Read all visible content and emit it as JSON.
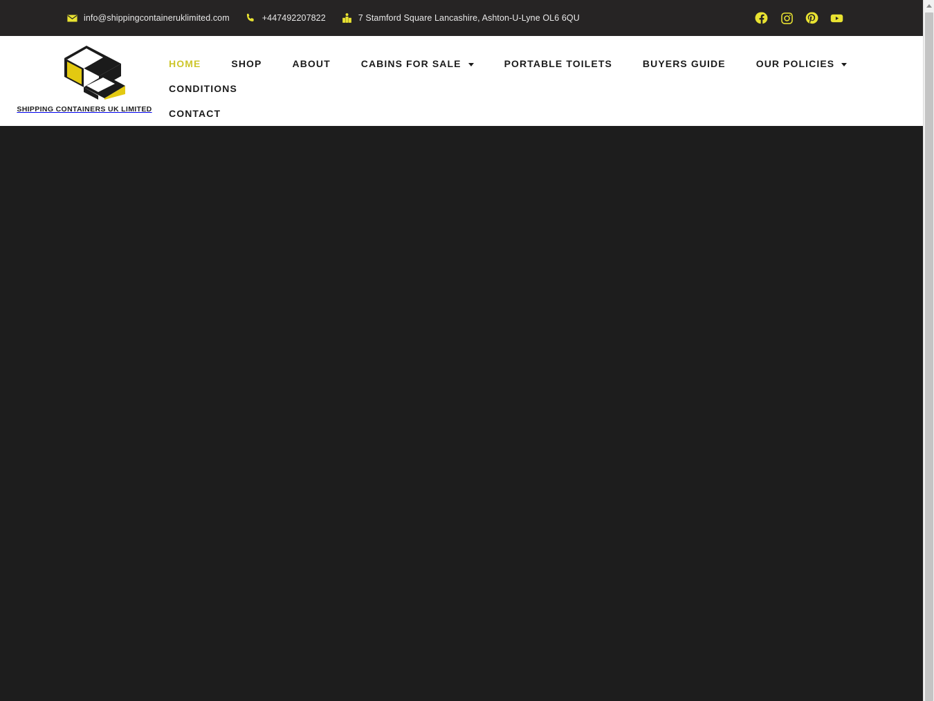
{
  "topbar": {
    "contacts": [
      {
        "icon": "envelope-icon",
        "label": "info@shippingcontaineruklimited.com",
        "name": "email"
      },
      {
        "icon": "phone-icon",
        "label": "+447492207822",
        "name": "phone"
      },
      {
        "icon": "map-location-icon",
        "label": "7 Stamford Square Lancashire, Ashton-U-Lyne OL6 6QU",
        "name": "address"
      }
    ],
    "socials": [
      {
        "icon": "facebook-icon",
        "name": "facebook"
      },
      {
        "icon": "instagram-icon",
        "name": "instagram"
      },
      {
        "icon": "pinterest-icon",
        "name": "pinterest"
      },
      {
        "icon": "youtube-icon",
        "name": "youtube"
      }
    ],
    "background_color": "#262424",
    "accent_color": "#e8e231"
  },
  "logo": {
    "text": "SHIPPING CONTAINERS UK LIMITED",
    "icon": "shipping-container-logo-icon",
    "colors": {
      "yellow": "#e3c911",
      "black": "#1b1b1b",
      "white": "#ffffff"
    }
  },
  "nav": {
    "row1": [
      {
        "label": "HOME",
        "active": true,
        "caret": false
      },
      {
        "label": "SHOP",
        "active": false,
        "caret": false
      },
      {
        "label": "ABOUT",
        "active": false,
        "caret": false
      },
      {
        "label": "CABINS FOR SALE",
        "active": false,
        "caret": true
      },
      {
        "label": "PORTABLE TOILETS",
        "active": false,
        "caret": false
      },
      {
        "label": "BUYERS GUIDE",
        "active": false,
        "caret": false
      },
      {
        "label": "OUR POLICIES",
        "active": false,
        "caret": true
      },
      {
        "label": "CONDITIONS",
        "active": false,
        "caret": false
      }
    ],
    "row2": [
      {
        "label": "CONTACT",
        "active": false,
        "caret": false
      }
    ],
    "active_color": "#cdc62c",
    "text_color": "#1b1b1b"
  },
  "content": {
    "background_color": "#1d1d1d"
  },
  "scrollbar": {
    "up_arrow_icon": "chevron-up-icon",
    "position": "right"
  }
}
